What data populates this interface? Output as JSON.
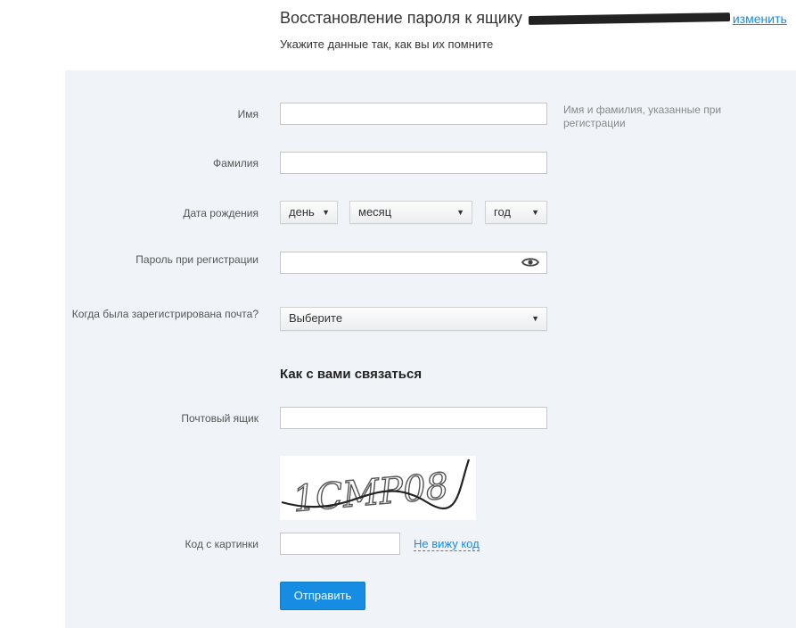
{
  "header": {
    "title": "Восстановление пароля к ящику",
    "change_link": "изменить",
    "subtitle": "Укажите данные так, как вы их помните"
  },
  "form": {
    "first_name": {
      "label": "Имя",
      "value": ""
    },
    "last_name": {
      "label": "Фамилия",
      "value": ""
    },
    "name_hint": "Имя и фамилия, указанные при регистрации",
    "birth_date": {
      "label": "Дата рождения",
      "day": "день",
      "month": "месяц",
      "year": "год"
    },
    "password": {
      "label": "Пароль при регистрации",
      "value": ""
    },
    "registered_when": {
      "label": "Когда была зарегистрирована почта?",
      "selected": "Выберите"
    },
    "contact_section_title": "Как с вами связаться",
    "mailbox": {
      "label": "Почтовый ящик",
      "value": ""
    },
    "captcha": {
      "label": "Код с картинки",
      "cant_see_link": "Не вижу код",
      "image_text": "1CMP08"
    },
    "submit_label": "Отправить"
  },
  "colors": {
    "accent": "#168de2",
    "panel_bg": "#f0f4f8"
  }
}
